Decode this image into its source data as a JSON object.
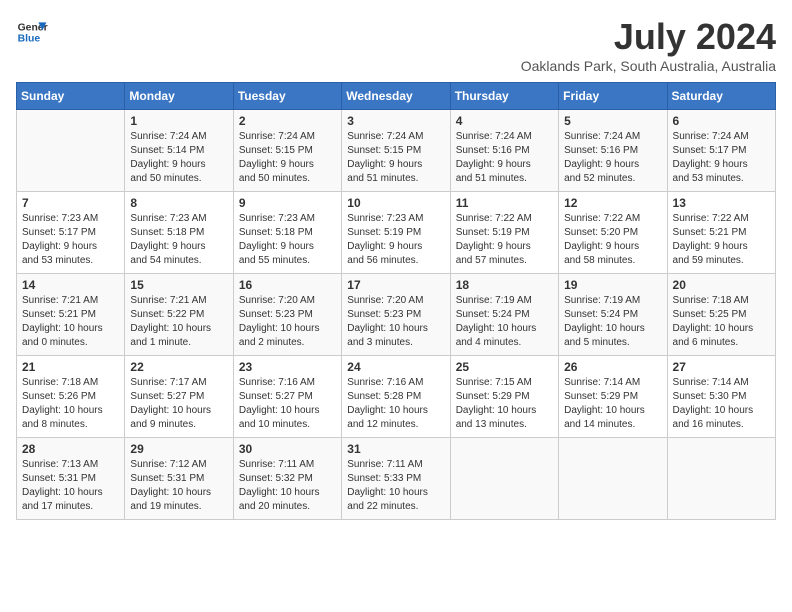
{
  "header": {
    "logo_line1": "General",
    "logo_line2": "Blue",
    "month": "July 2024",
    "location": "Oaklands Park, South Australia, Australia"
  },
  "days_of_week": [
    "Sunday",
    "Monday",
    "Tuesday",
    "Wednesday",
    "Thursday",
    "Friday",
    "Saturday"
  ],
  "weeks": [
    [
      {
        "day": "",
        "content": ""
      },
      {
        "day": "1",
        "content": "Sunrise: 7:24 AM\nSunset: 5:14 PM\nDaylight: 9 hours\nand 50 minutes."
      },
      {
        "day": "2",
        "content": "Sunrise: 7:24 AM\nSunset: 5:15 PM\nDaylight: 9 hours\nand 50 minutes."
      },
      {
        "day": "3",
        "content": "Sunrise: 7:24 AM\nSunset: 5:15 PM\nDaylight: 9 hours\nand 51 minutes."
      },
      {
        "day": "4",
        "content": "Sunrise: 7:24 AM\nSunset: 5:16 PM\nDaylight: 9 hours\nand 51 minutes."
      },
      {
        "day": "5",
        "content": "Sunrise: 7:24 AM\nSunset: 5:16 PM\nDaylight: 9 hours\nand 52 minutes."
      },
      {
        "day": "6",
        "content": "Sunrise: 7:24 AM\nSunset: 5:17 PM\nDaylight: 9 hours\nand 53 minutes."
      }
    ],
    [
      {
        "day": "7",
        "content": "Sunrise: 7:23 AM\nSunset: 5:17 PM\nDaylight: 9 hours\nand 53 minutes."
      },
      {
        "day": "8",
        "content": "Sunrise: 7:23 AM\nSunset: 5:18 PM\nDaylight: 9 hours\nand 54 minutes."
      },
      {
        "day": "9",
        "content": "Sunrise: 7:23 AM\nSunset: 5:18 PM\nDaylight: 9 hours\nand 55 minutes."
      },
      {
        "day": "10",
        "content": "Sunrise: 7:23 AM\nSunset: 5:19 PM\nDaylight: 9 hours\nand 56 minutes."
      },
      {
        "day": "11",
        "content": "Sunrise: 7:22 AM\nSunset: 5:19 PM\nDaylight: 9 hours\nand 57 minutes."
      },
      {
        "day": "12",
        "content": "Sunrise: 7:22 AM\nSunset: 5:20 PM\nDaylight: 9 hours\nand 58 minutes."
      },
      {
        "day": "13",
        "content": "Sunrise: 7:22 AM\nSunset: 5:21 PM\nDaylight: 9 hours\nand 59 minutes."
      }
    ],
    [
      {
        "day": "14",
        "content": "Sunrise: 7:21 AM\nSunset: 5:21 PM\nDaylight: 10 hours\nand 0 minutes."
      },
      {
        "day": "15",
        "content": "Sunrise: 7:21 AM\nSunset: 5:22 PM\nDaylight: 10 hours\nand 1 minute."
      },
      {
        "day": "16",
        "content": "Sunrise: 7:20 AM\nSunset: 5:23 PM\nDaylight: 10 hours\nand 2 minutes."
      },
      {
        "day": "17",
        "content": "Sunrise: 7:20 AM\nSunset: 5:23 PM\nDaylight: 10 hours\nand 3 minutes."
      },
      {
        "day": "18",
        "content": "Sunrise: 7:19 AM\nSunset: 5:24 PM\nDaylight: 10 hours\nand 4 minutes."
      },
      {
        "day": "19",
        "content": "Sunrise: 7:19 AM\nSunset: 5:24 PM\nDaylight: 10 hours\nand 5 minutes."
      },
      {
        "day": "20",
        "content": "Sunrise: 7:18 AM\nSunset: 5:25 PM\nDaylight: 10 hours\nand 6 minutes."
      }
    ],
    [
      {
        "day": "21",
        "content": "Sunrise: 7:18 AM\nSunset: 5:26 PM\nDaylight: 10 hours\nand 8 minutes."
      },
      {
        "day": "22",
        "content": "Sunrise: 7:17 AM\nSunset: 5:27 PM\nDaylight: 10 hours\nand 9 minutes."
      },
      {
        "day": "23",
        "content": "Sunrise: 7:16 AM\nSunset: 5:27 PM\nDaylight: 10 hours\nand 10 minutes."
      },
      {
        "day": "24",
        "content": "Sunrise: 7:16 AM\nSunset: 5:28 PM\nDaylight: 10 hours\nand 12 minutes."
      },
      {
        "day": "25",
        "content": "Sunrise: 7:15 AM\nSunset: 5:29 PM\nDaylight: 10 hours\nand 13 minutes."
      },
      {
        "day": "26",
        "content": "Sunrise: 7:14 AM\nSunset: 5:29 PM\nDaylight: 10 hours\nand 14 minutes."
      },
      {
        "day": "27",
        "content": "Sunrise: 7:14 AM\nSunset: 5:30 PM\nDaylight: 10 hours\nand 16 minutes."
      }
    ],
    [
      {
        "day": "28",
        "content": "Sunrise: 7:13 AM\nSunset: 5:31 PM\nDaylight: 10 hours\nand 17 minutes."
      },
      {
        "day": "29",
        "content": "Sunrise: 7:12 AM\nSunset: 5:31 PM\nDaylight: 10 hours\nand 19 minutes."
      },
      {
        "day": "30",
        "content": "Sunrise: 7:11 AM\nSunset: 5:32 PM\nDaylight: 10 hours\nand 20 minutes."
      },
      {
        "day": "31",
        "content": "Sunrise: 7:11 AM\nSunset: 5:33 PM\nDaylight: 10 hours\nand 22 minutes."
      },
      {
        "day": "",
        "content": ""
      },
      {
        "day": "",
        "content": ""
      },
      {
        "day": "",
        "content": ""
      }
    ]
  ]
}
